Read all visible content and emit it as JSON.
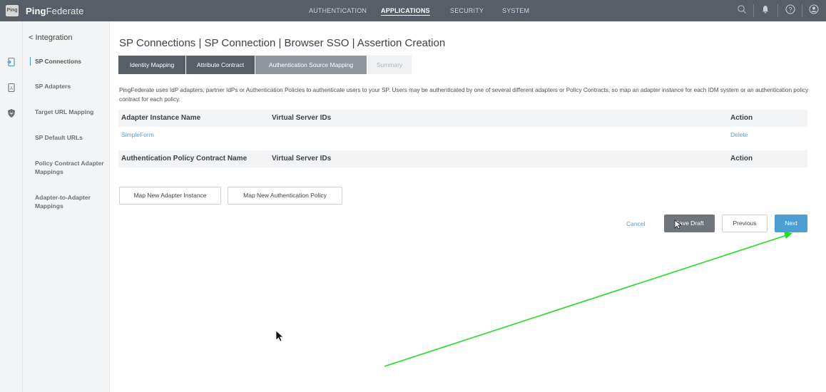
{
  "app": {
    "logo_text": "Ping",
    "brand_bold": "Ping",
    "brand_rest": "Federate"
  },
  "topnav": [
    "AUTHENTICATION",
    "APPLICATIONS",
    "SECURITY",
    "SYSTEM"
  ],
  "topnav_active": "APPLICATIONS",
  "topbar_icons": [
    "search-icon",
    "bell-icon",
    "help-icon",
    "user-icon"
  ],
  "rail_icons": [
    "connections-icon",
    "adapter-icon",
    "shield-icon"
  ],
  "sidebar": {
    "back_label": "< Integration",
    "items": [
      {
        "label": "SP Connections"
      },
      {
        "label": "SP Adapters"
      },
      {
        "label": "Target URL Mapping"
      },
      {
        "label": "SP Default URLs"
      },
      {
        "label": "Policy Contract Adapter Mappings"
      },
      {
        "label": "Adapter-to-Adapter Mappings"
      }
    ]
  },
  "breadcrumb": "SP Connections | SP Connection | Browser SSO | Assertion Creation",
  "tabs": [
    {
      "label": "Identity Mapping"
    },
    {
      "label": "Attribute Contract"
    },
    {
      "label": "Authentication Source Mapping"
    },
    {
      "label": "Summary"
    }
  ],
  "description": "PingFederate uses IdP adapters, partner IdPs or Authentication Policies to authenticate users to your SP. Users may be authenticated by one of several different adapters or Policy Contracts, so map an adapter instance for each IDM system or an authentication policy contract for each policy.",
  "adapter_table": {
    "headers": [
      "Adapter Instance Name",
      "Virtual Server IDs",
      "Action"
    ],
    "rows": [
      {
        "name": "SimpleForm",
        "virtual_server_ids": "",
        "action": "Delete"
      }
    ]
  },
  "policy_table": {
    "headers": [
      "Authentication Policy Contract Name",
      "Virtual Server IDs",
      "Action"
    ]
  },
  "buttons": {
    "map_adapter": "Map New Adapter Instance",
    "map_policy": "Map New Authentication Policy",
    "cancel": "Cancel",
    "save_draft": "Save Draft",
    "previous": "Previous",
    "next": "Next"
  },
  "colors": {
    "topbar": "#575e66",
    "primary_button": "#4c9fd5",
    "link": "#5a9bd0",
    "annotation_arrow": "#22dd22"
  }
}
